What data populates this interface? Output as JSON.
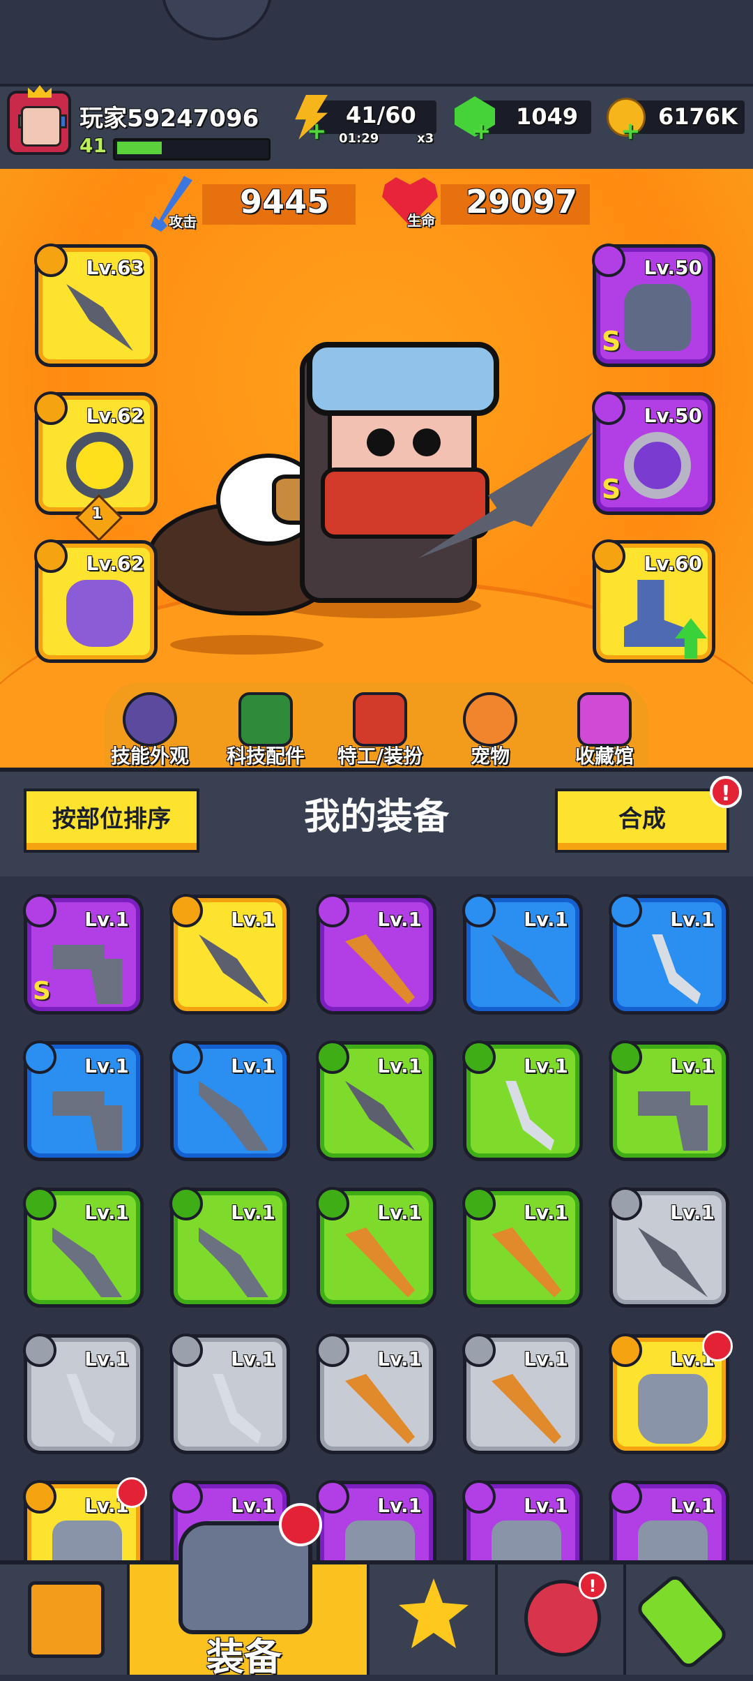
{
  "player": {
    "name": "玩家59247096",
    "level": "41",
    "xp_fraction": 0.3
  },
  "resources": {
    "energy": {
      "value": "41/60",
      "timer": "01:29",
      "multiplier": "x3"
    },
    "gems": {
      "value": "1049"
    },
    "coins": {
      "value": "6176K"
    }
  },
  "stats": {
    "attack": {
      "label": "攻击",
      "value": "9445"
    },
    "hp": {
      "label": "生命",
      "value": "29097"
    }
  },
  "equipped": {
    "weapon": {
      "level": "Lv.63",
      "icon": "kunai-icon"
    },
    "ring": {
      "level": "Lv.62",
      "icon": "ring-icon",
      "badge": "1"
    },
    "glove": {
      "level": "Lv.62",
      "icon": "glove-icon"
    },
    "armor": {
      "level": "Lv.50",
      "icon": "helmet-armor-icon",
      "rank": "S"
    },
    "belt": {
      "level": "Lv.50",
      "icon": "belt-icon",
      "rank": "S"
    },
    "boots": {
      "level": "Lv.60",
      "icon": "boots-icon"
    }
  },
  "menu": {
    "skin": "技能外观",
    "tech": "科技配件",
    "agent": "特工/装扮",
    "pet": "宠物",
    "collection": "收藏馆"
  },
  "equipment_panel": {
    "title": "我的装备",
    "sort_label": "按部位排序",
    "merge_label": "合成",
    "merge_alert": "!"
  },
  "inventory": [
    {
      "level": "Lv.1",
      "rarity": "purple",
      "item": "blaster",
      "rank": "S"
    },
    {
      "level": "Lv.1",
      "rarity": "yellow",
      "item": "kunai"
    },
    {
      "level": "Lv.1",
      "rarity": "purple",
      "item": "bat"
    },
    {
      "level": "Lv.1",
      "rarity": "blue",
      "item": "kunai"
    },
    {
      "level": "Lv.1",
      "rarity": "blue",
      "item": "sword"
    },
    {
      "level": "Lv.1",
      "rarity": "blue",
      "item": "pistol"
    },
    {
      "level": "Lv.1",
      "rarity": "blue",
      "item": "shotgun"
    },
    {
      "level": "Lv.1",
      "rarity": "green",
      "item": "kunai"
    },
    {
      "level": "Lv.1",
      "rarity": "green",
      "item": "sword"
    },
    {
      "level": "Lv.1",
      "rarity": "green",
      "item": "pistol"
    },
    {
      "level": "Lv.1",
      "rarity": "green",
      "item": "shotgun"
    },
    {
      "level": "Lv.1",
      "rarity": "green",
      "item": "shotgun"
    },
    {
      "level": "Lv.1",
      "rarity": "green",
      "item": "bat"
    },
    {
      "level": "Lv.1",
      "rarity": "green",
      "item": "bat"
    },
    {
      "level": "Lv.1",
      "rarity": "gray",
      "item": "kunai"
    },
    {
      "level": "Lv.1",
      "rarity": "gray",
      "item": "sword"
    },
    {
      "level": "Lv.1",
      "rarity": "gray",
      "item": "sword"
    },
    {
      "level": "Lv.1",
      "rarity": "gray",
      "item": "bat"
    },
    {
      "level": "Lv.1",
      "rarity": "gray",
      "item": "bat"
    },
    {
      "level": "Lv.1",
      "rarity": "yellow",
      "item": "armor",
      "alert": true
    },
    {
      "level": "Lv.1",
      "rarity": "yellow",
      "item": "armor",
      "alert": true
    },
    {
      "level": "Lv.1",
      "rarity": "purple",
      "item": "armor"
    },
    {
      "level": "Lv.1",
      "rarity": "purple",
      "item": "armor"
    },
    {
      "level": "Lv.1",
      "rarity": "purple",
      "item": "armor"
    },
    {
      "level": "Lv.1",
      "rarity": "purple",
      "item": "armor"
    }
  ],
  "bottom_nav": {
    "shop": "shop-icon",
    "equip": "装备",
    "battle": "battle-icon",
    "event": "event-icon",
    "event_alert": "!",
    "lab": "lab-icon"
  }
}
